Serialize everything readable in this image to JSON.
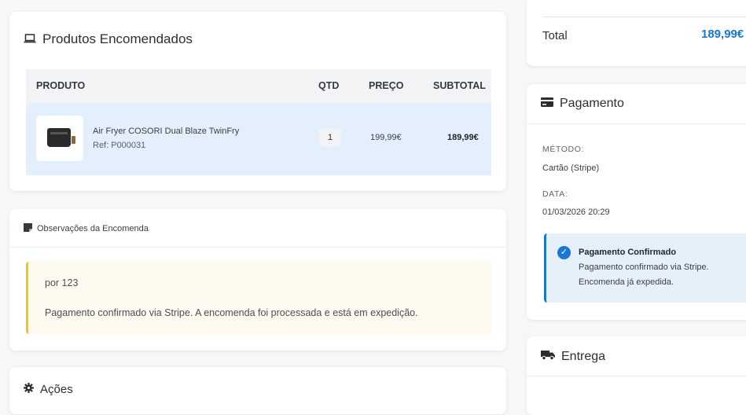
{
  "products_card": {
    "title": "Produtos Encomendados",
    "icon": "laptop-icon",
    "columns": [
      "PRODUTO",
      "QTD",
      "PREÇO",
      "SUBTOTAL"
    ],
    "rows": [
      {
        "name": "Air Fryer COSORI Dual Blaze TwinFry",
        "ref": "Ref: P000031",
        "qty": "1",
        "price": "199,99€",
        "subtotal": "189,99€",
        "image": "air-fryer-image"
      }
    ]
  },
  "notes_card": {
    "title": "Observações da Encomenda",
    "icon": "note-icon",
    "lines": [
      "por 123",
      "Pagamento confirmado via Stripe. A encomenda foi processada e está em expedição."
    ]
  },
  "actions_card": {
    "title": "Ações",
    "icon": "gear-icon"
  },
  "total_card": {
    "label": "Total",
    "value": "189,99€"
  },
  "payment_card": {
    "title": "Pagamento",
    "icon": "credit-card-icon",
    "method_label": "MÉTODO:",
    "method_value": "Cartão (Stripe)",
    "date_label": "DATA:",
    "date_value": "01/03/2026 20:29",
    "confirmation": {
      "title": "Pagamento Confirmado",
      "line1": "Pagamento confirmado via Stripe.",
      "line2": "Encomenda já expedida."
    }
  },
  "delivery_card": {
    "title": "Entrega",
    "icon": "truck-icon"
  },
  "colors": {
    "accent": "#1976d2",
    "row_highlight": "#e4effd",
    "note_border": "#f0c419",
    "note_bg": "#fffaf0"
  }
}
